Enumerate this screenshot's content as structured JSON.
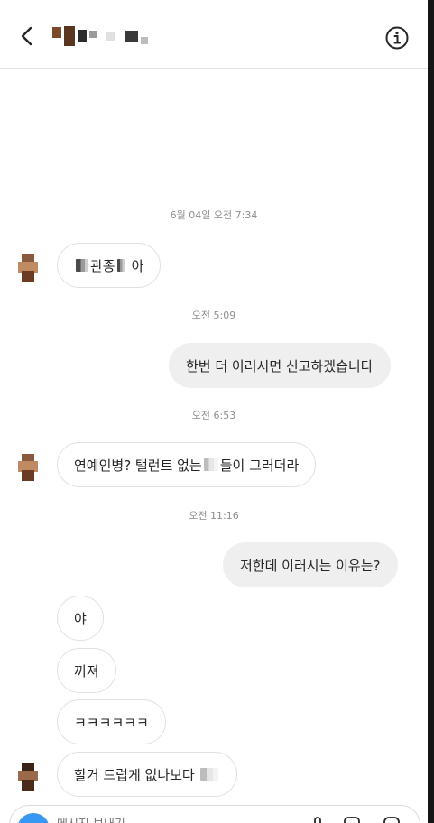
{
  "header": {
    "contact_name": "",
    "back_icon": "chevron-left-icon",
    "info_icon": "info-icon"
  },
  "messages": {
    "ts1": "6월 04일 오전 7:34",
    "m1_text": "관종",
    "m1_suffix": "아",
    "ts2": "오전 5:09",
    "m2_text": "한번 더 이러시면 신고하겠습니다",
    "ts3": "오전 6:53",
    "m3_text": "연예인병? 탤런트 없는",
    "m3_suffix": "들이 그러더라",
    "ts4": "오전 11:16",
    "m4_text": "저한데 이러시는 이유는?",
    "m5_text": "야",
    "m6_text": "꺼져",
    "m7_text": "ㅋㅋㅋㅋㅋㅋ",
    "m8_text": "할거 드럽게 없나보다"
  },
  "composer": {
    "placeholder": "메시지 보내기..."
  },
  "colors": {
    "accent": "#3897f0",
    "outgoing_bubble": "#efefef",
    "incoming_border": "#e1e1e1"
  }
}
